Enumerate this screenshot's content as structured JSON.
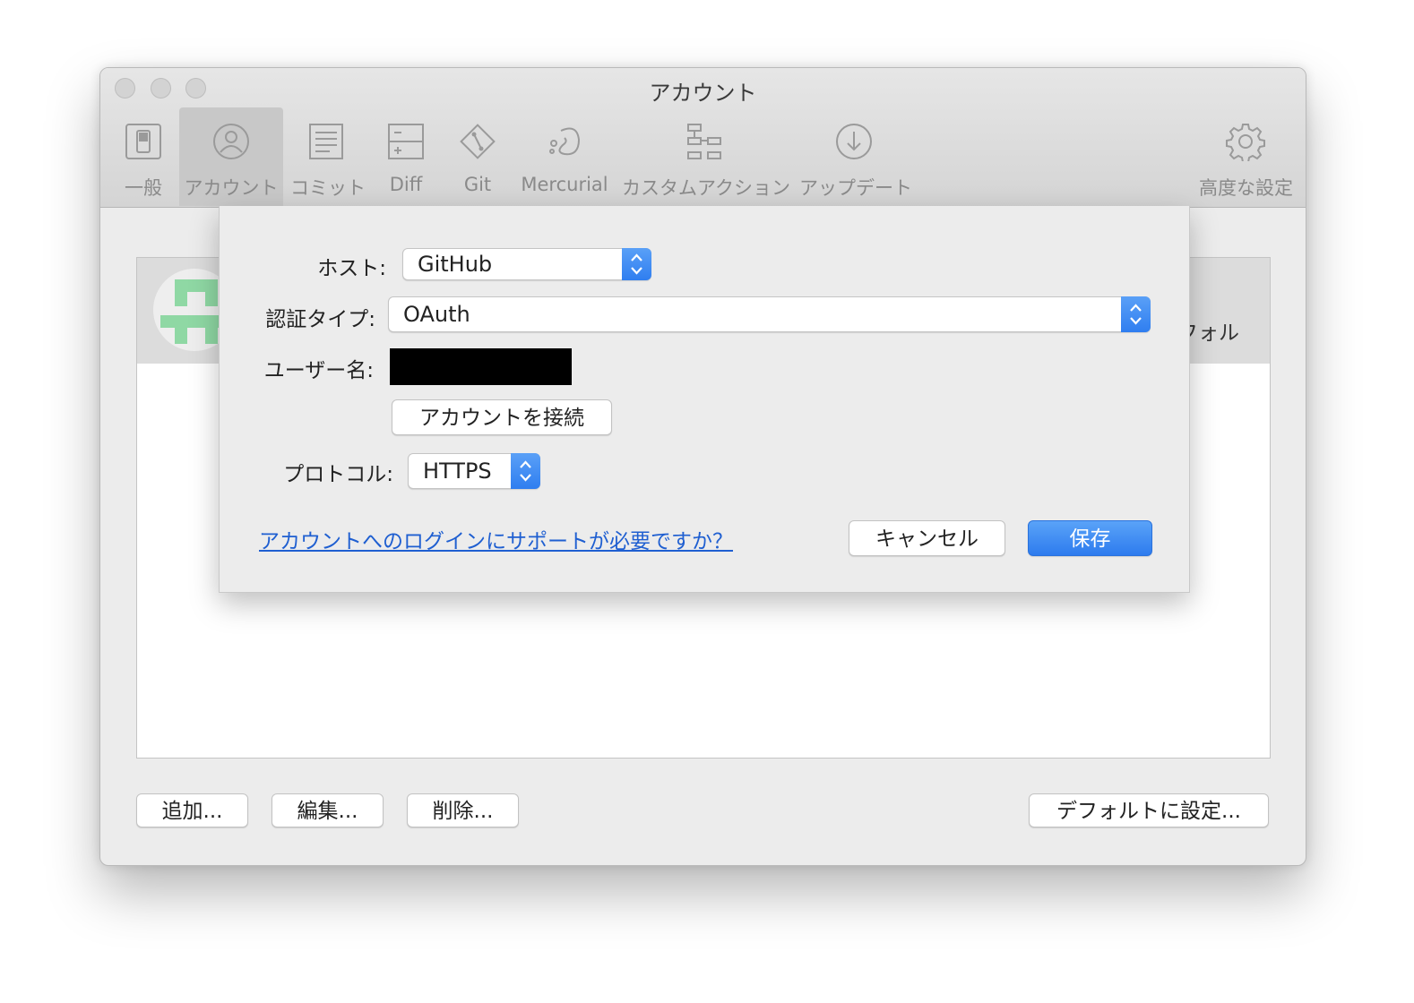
{
  "window": {
    "title": "アカウント"
  },
  "toolbar": {
    "items": [
      {
        "label": "一般",
        "icon": "general-switch-icon"
      },
      {
        "label": "アカウント",
        "icon": "account-person-icon",
        "active": true
      },
      {
        "label": "コミット",
        "icon": "commit-document-icon"
      },
      {
        "label": "Diff",
        "icon": "diff-icon"
      },
      {
        "label": "Git",
        "icon": "git-icon"
      },
      {
        "label": "Mercurial",
        "icon": "mercurial-icon"
      },
      {
        "label": "カスタムアクション",
        "icon": "custom-action-icon"
      },
      {
        "label": "アップデート",
        "icon": "update-download-icon"
      },
      {
        "label": "高度な設定",
        "icon": "gear-icon"
      }
    ]
  },
  "account_list": {
    "row_tail_text": "フォル"
  },
  "bottom_buttons": {
    "add": "追加...",
    "edit": "編集...",
    "delete": "削除...",
    "set_default": "デフォルトに設定..."
  },
  "sheet": {
    "host_label": "ホスト:",
    "host_value": "GitHub",
    "auth_label": "認証タイプ:",
    "auth_value": "OAuth",
    "username_label": "ユーザー名:",
    "connect_button": "アカウントを接続",
    "protocol_label": "プロトコル:",
    "protocol_value": "HTTPS",
    "help_link": "アカウントへのログインにサポートが必要ですか？",
    "cancel_button": "キャンセル",
    "save_button": "保存"
  },
  "colors": {
    "accent": "#2f7ef0",
    "link": "#1f5fd1",
    "avatar": "#8fd8a4"
  }
}
